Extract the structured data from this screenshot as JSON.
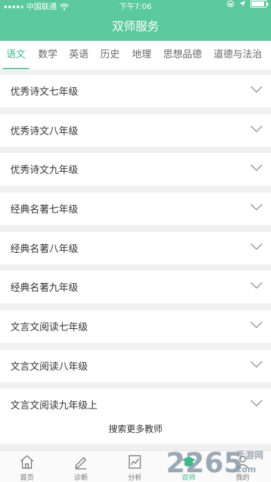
{
  "status_bar": {
    "carrier": "中国联通",
    "time": "下午7:06"
  },
  "header": {
    "title": "双师服务"
  },
  "tabs": [
    {
      "label": "语文",
      "active": true
    },
    {
      "label": "数学",
      "active": false
    },
    {
      "label": "英语",
      "active": false
    },
    {
      "label": "历史",
      "active": false
    },
    {
      "label": "地理",
      "active": false
    },
    {
      "label": "思想品德",
      "active": false
    },
    {
      "label": "道德与法治",
      "active": false
    }
  ],
  "list": [
    {
      "label": "优秀诗文七年级"
    },
    {
      "label": "优秀诗文八年级"
    },
    {
      "label": "优秀诗文九年级"
    },
    {
      "label": "经典名著七年级"
    },
    {
      "label": "经典名著八年级"
    },
    {
      "label": "经典名著九年级"
    },
    {
      "label": "文言文阅读七年级"
    },
    {
      "label": "文言文阅读八年级"
    },
    {
      "label": "文言文阅读九年级上"
    }
  ],
  "search_more": "搜索更多教师",
  "tabbar": [
    {
      "label": "首页",
      "icon": "home-icon",
      "active": false
    },
    {
      "label": "诊断",
      "icon": "pen-icon",
      "active": false
    },
    {
      "label": "分析",
      "icon": "chart-icon",
      "active": false
    },
    {
      "label": "双师",
      "icon": "graduation-cap-icon",
      "active": true
    },
    {
      "label": "我的",
      "icon": "person-icon",
      "active": false
    }
  ],
  "watermark": {
    "number": "2265",
    "suffix": ".com",
    "text": "手游网"
  },
  "colors": {
    "accent": "#5bc99c",
    "active_text": "#3fb987"
  }
}
